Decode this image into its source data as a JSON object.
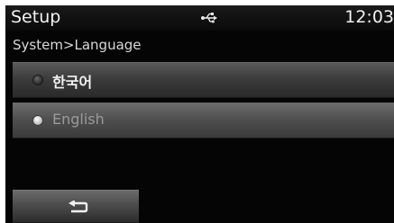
{
  "header": {
    "title": "Setup",
    "status_icon": "usb-icon",
    "time": "12:03"
  },
  "breadcrumb": "System>Language",
  "languages": [
    {
      "label": "한국어",
      "selected": false
    },
    {
      "label": "English",
      "selected": true
    }
  ],
  "footer": {
    "back_icon": "back-arrow-icon"
  }
}
